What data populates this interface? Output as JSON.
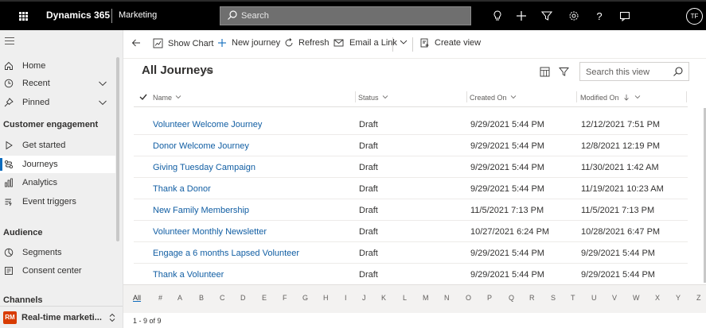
{
  "topbar": {
    "app_name": "Dynamics 365",
    "module_name": "Marketing",
    "search_placeholder": "Search",
    "user_initials": "TF"
  },
  "sidebar": {
    "items_top": [
      {
        "label": "Home",
        "icon": "home-icon"
      },
      {
        "label": "Recent",
        "icon": "clock-icon"
      },
      {
        "label": "Pinned",
        "icon": "pin-icon"
      }
    ],
    "section_customer": "Customer engagement",
    "items_customer": [
      {
        "label": "Get started",
        "icon": "play-icon"
      },
      {
        "label": "Journeys",
        "icon": "journey-icon"
      },
      {
        "label": "Analytics",
        "icon": "analytics-icon"
      },
      {
        "label": "Event triggers",
        "icon": "event-trigger-icon"
      }
    ],
    "section_audience": "Audience",
    "items_audience": [
      {
        "label": "Segments",
        "icon": "segments-icon"
      },
      {
        "label": "Consent center",
        "icon": "consent-icon"
      }
    ],
    "section_channels": "Channels",
    "area_badge": "RM",
    "area_label": "Real-time marketi...",
    "area_badge_color": "#d83b01"
  },
  "commands": {
    "show_chart": "Show Chart",
    "new_journey": "New journey",
    "refresh": "Refresh",
    "email_link": "Email a Link",
    "create_view": "Create view"
  },
  "view": {
    "title": "All Journeys",
    "search_placeholder": "Search this view"
  },
  "columns": {
    "name": "Name",
    "status": "Status",
    "created_on": "Created On",
    "modified_on": "Modified On"
  },
  "rows": [
    {
      "name": "Volunteer Welcome Journey",
      "status": "Draft",
      "created": "9/29/2021 5:44 PM",
      "modified": "12/12/2021 7:51 PM"
    },
    {
      "name": "Donor Welcome Journey",
      "status": "Draft",
      "created": "9/29/2021 5:44 PM",
      "modified": "12/8/2021 12:19 PM"
    },
    {
      "name": "Giving Tuesday Campaign",
      "status": "Draft",
      "created": "9/29/2021 5:44 PM",
      "modified": "11/30/2021 1:42 AM"
    },
    {
      "name": "Thank a Donor",
      "status": "Draft",
      "created": "9/29/2021 5:44 PM",
      "modified": "11/19/2021 10:23 AM"
    },
    {
      "name": "New Family Membership",
      "status": "Draft",
      "created": "11/5/2021 7:13 PM",
      "modified": "11/5/2021 7:13 PM"
    },
    {
      "name": "Volunteer Monthly Newsletter",
      "status": "Draft",
      "created": "10/27/2021 6:24 PM",
      "modified": "10/28/2021 6:47 PM"
    },
    {
      "name": "Engage a 6 months Lapsed Volunteer",
      "status": "Draft",
      "created": "9/29/2021 5:44 PM",
      "modified": "9/29/2021 5:44 PM"
    },
    {
      "name": "Thank a Volunteer",
      "status": "Draft",
      "created": "9/29/2021 5:44 PM",
      "modified": "9/29/2021 5:44 PM"
    }
  ],
  "alphabet": [
    "All",
    "#",
    "A",
    "B",
    "C",
    "D",
    "E",
    "F",
    "G",
    "H",
    "I",
    "J",
    "K",
    "L",
    "M",
    "N",
    "O",
    "P",
    "Q",
    "R",
    "S",
    "T",
    "U",
    "V",
    "W",
    "X",
    "Y",
    "Z"
  ],
  "pager": "1 - 9 of 9",
  "colors": {
    "topbar_bg": "#000000",
    "link": "#115ea3",
    "accent": "#0f6cbd"
  }
}
